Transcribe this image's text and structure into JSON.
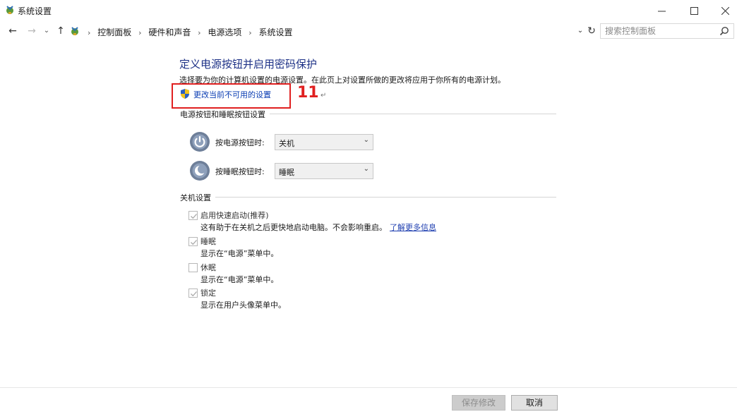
{
  "window": {
    "title": "系统设置",
    "minimize_glyph": "—",
    "maximize_glyph": "☐",
    "close_glyph": "✕"
  },
  "nav": {
    "back_glyph": "←",
    "forward_glyph": "→",
    "recent_glyph": "⌄",
    "up_glyph": "↑",
    "breadcrumb": [
      "控制面板",
      "硬件和声音",
      "电源选项",
      "系统设置"
    ],
    "separator": "›",
    "dropdown_glyph": "⌄",
    "refresh_glyph": "↻"
  },
  "search": {
    "placeholder": "搜索控制面板",
    "value": ""
  },
  "page": {
    "heading": "定义电源按钮并启用密码保护",
    "description": "选择要为你的计算机设置的电源设置。在此页上对设置所做的更改将应用于你所有的电源计划。",
    "change_link": "更改当前不可用的设置"
  },
  "annotation": {
    "number": "11",
    "return_mark": "↵",
    "color": "#e02020"
  },
  "power_section": {
    "label": "电源按钮和睡眠按钮设置",
    "rows": [
      {
        "label": "按电源按钮时:",
        "value": "关机",
        "icon": "power-icon"
      },
      {
        "label": "按睡眠按钮时:",
        "value": "睡眠",
        "icon": "sleep-icon"
      }
    ],
    "select_arrow": "⌄"
  },
  "shutdown_section": {
    "label": "关机设置",
    "options": [
      {
        "title": "启用快速启动(推荐)",
        "desc": "这有助于在关机之后更快地启动电脑。不会影响重启。",
        "link": "了解更多信息",
        "checked": true,
        "disabled": true
      },
      {
        "title": "睡眠",
        "desc": "显示在“电源”菜单中。",
        "checked": true,
        "disabled": true
      },
      {
        "title": "休眠",
        "desc": "显示在“电源”菜单中。",
        "checked": false,
        "disabled": true
      },
      {
        "title": "锁定",
        "desc": "显示在用户头像菜单中。",
        "checked": true,
        "disabled": true
      }
    ]
  },
  "footer": {
    "save_label": "保存修改",
    "cancel_label": "取消"
  },
  "colors": {
    "link": "#0a3db3",
    "heading": "#1e3287",
    "annotation": "#e02020"
  }
}
